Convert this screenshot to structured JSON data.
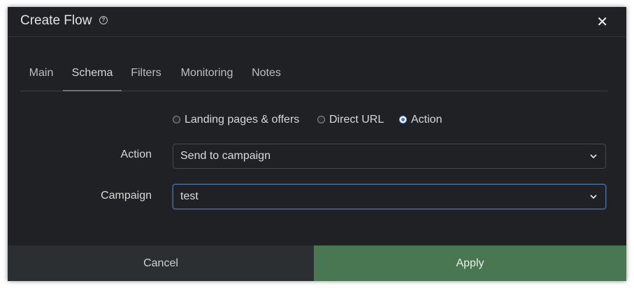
{
  "dialog": {
    "title": "Create Flow",
    "help_icon": "question-circle-icon",
    "close_icon": "close-icon",
    "close_glyph": "✕"
  },
  "tabs": [
    {
      "label": "Main",
      "active": false
    },
    {
      "label": "Schema",
      "active": true
    },
    {
      "label": "Filters",
      "active": false
    },
    {
      "label": "Monitoring",
      "active": false
    },
    {
      "label": "Notes",
      "active": false
    }
  ],
  "schema": {
    "options": [
      {
        "label": "Landing pages & offers",
        "checked": false
      },
      {
        "label": "Direct URL",
        "checked": false
      },
      {
        "label": "Action",
        "checked": true
      }
    ],
    "action": {
      "label": "Action",
      "value": "Send to campaign"
    },
    "campaign": {
      "label": "Campaign",
      "value": "test"
    }
  },
  "footer": {
    "cancel_label": "Cancel",
    "apply_label": "Apply"
  },
  "colors": {
    "background": "#202124",
    "apply": "#497752",
    "cancel": "#2c2f32",
    "radio_checked": "#3a78d8"
  }
}
